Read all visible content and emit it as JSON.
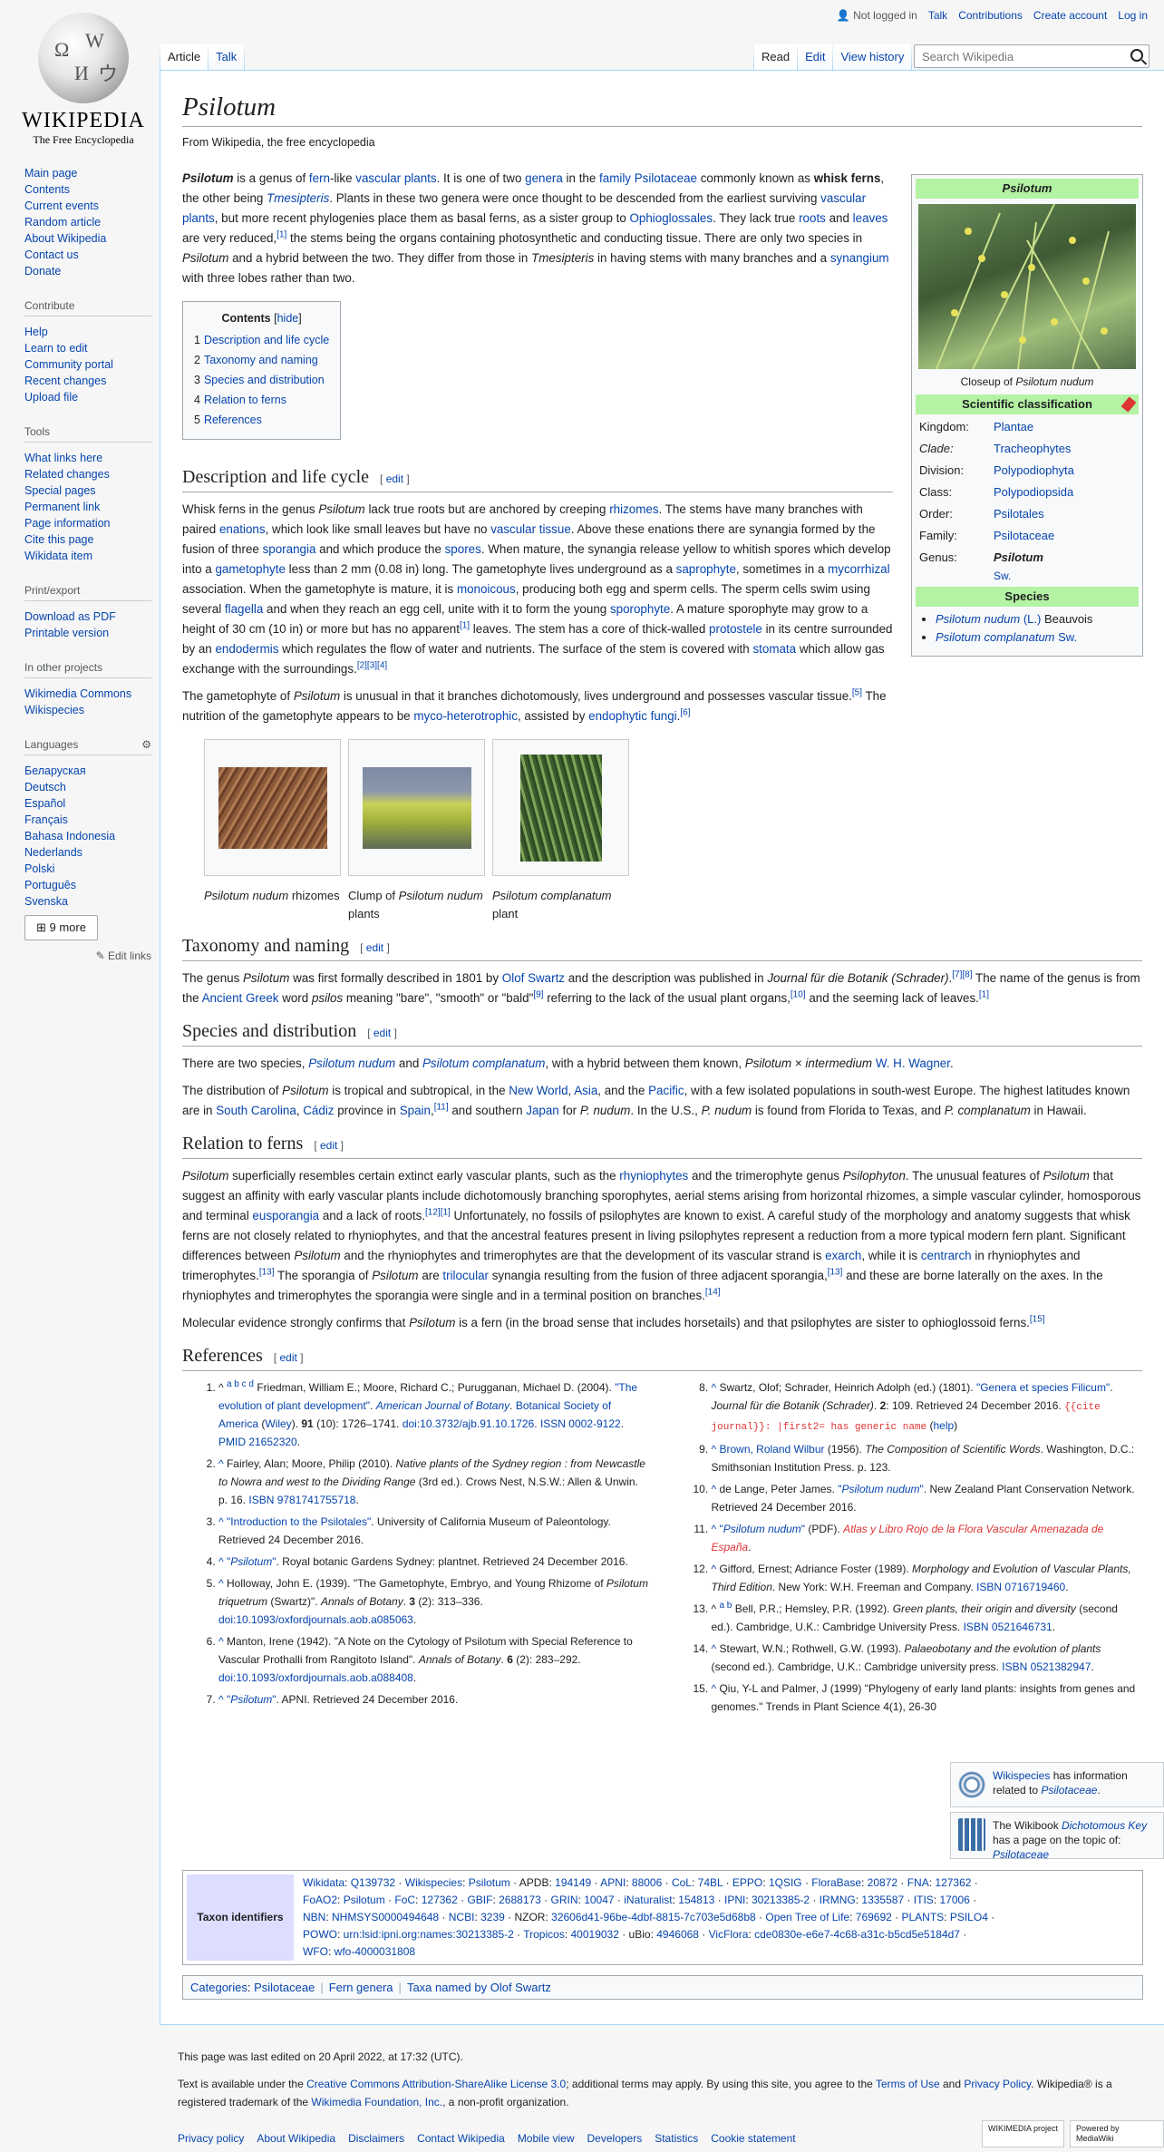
{
  "personal": {
    "not_logged": "Not logged in",
    "talk": "Talk",
    "contributions": "Contributions",
    "create": "Create account",
    "login": "Log in"
  },
  "logo": {
    "wordmark": "WIKIPEDIA",
    "tagline": "The Free Encyclopedia"
  },
  "tabs": {
    "article": "Article",
    "talk": "Talk",
    "read": "Read",
    "edit": "Edit",
    "history": "View history"
  },
  "search": {
    "placeholder": "Search Wikipedia"
  },
  "sidebar": {
    "nav": [
      "Main page",
      "Contents",
      "Current events",
      "Random article",
      "About Wikipedia",
      "Contact us",
      "Donate"
    ],
    "contribute_h": "Contribute",
    "contribute": [
      "Help",
      "Learn to edit",
      "Community portal",
      "Recent changes",
      "Upload file"
    ],
    "tools_h": "Tools",
    "tools": [
      "What links here",
      "Related changes",
      "Special pages",
      "Permanent link",
      "Page information",
      "Cite this page",
      "Wikidata item"
    ],
    "print_h": "Print/export",
    "print": [
      "Download as PDF",
      "Printable version"
    ],
    "projects_h": "In other projects",
    "projects": [
      "Wikimedia Commons",
      "Wikispecies"
    ],
    "lang_h": "Languages",
    "langs": [
      "Беларуская",
      "Deutsch",
      "Español",
      "Français",
      "Bahasa Indonesia",
      "Nederlands",
      "Polski",
      "Português",
      "Svenska"
    ],
    "more": "9 more",
    "edit_links": "Edit links"
  },
  "article": {
    "title": "Psilotum",
    "from": "From Wikipedia, the free encyclopedia"
  },
  "infobox": {
    "title": "Psilotum",
    "caption_pre": "Closeup of ",
    "caption_it": "Psilotum nudum",
    "sci": "Scientific classification",
    "rows": [
      [
        "Kingdom:",
        "Plantae"
      ],
      [
        "Clade:",
        "Tracheophytes"
      ],
      [
        "Division:",
        "Polypodiophyta"
      ],
      [
        "Class:",
        "Polypodiopsida"
      ],
      [
        "Order:",
        "Psilotales"
      ],
      [
        "Family:",
        "Psilotaceae"
      ],
      [
        "Genus:",
        "Psilotum"
      ]
    ],
    "genus_auth": "Sw.",
    "species_h": "Species",
    "sp1": "Psilotum nudum",
    "sp1a": "(L.)",
    "sp1b": " Beauvois",
    "sp2": "Psilotum complanatum",
    "sp2a": "Sw."
  },
  "toc": {
    "title": "Contents",
    "hide": "hide",
    "items": [
      "Description and life cycle",
      "Taxonomy and naming",
      "Species and distribution",
      "Relation to ferns",
      "References"
    ]
  },
  "sections": {
    "desc": "Description and life cycle",
    "tax": "Taxonomy and naming",
    "spec": "Species and distribution",
    "rel": "Relation to ferns",
    "refs": "References",
    "edit": "edit"
  },
  "gallery": [
    {
      "it": "Psilotum nudum",
      "rest": " rhizomes",
      "pre": ""
    },
    {
      "pre": "Clump of ",
      "it": "Psilotum nudum",
      "rest": " plants"
    },
    {
      "pre": "",
      "it": "Psilotum complanatum",
      "rest": " plant"
    }
  ],
  "sister": {
    "ws_a": "Wikispecies",
    "ws_b": " has information related to ",
    "ws_c": "Psilotaceae",
    "wb_a": "The Wikibook ",
    "wb_b": "Dichotomous Key",
    "wb_c": " has a page on the topic of: ",
    "wb_d": "Psilotaceae"
  },
  "taxon": {
    "label": "Taxon identifiers"
  },
  "cats": {
    "label": "Categories",
    "items": [
      "Psilotaceae",
      "Fern genera",
      "Taxa named by Olof Swartz"
    ]
  },
  "footer": {
    "edited": "This page was last edited on 20 April 2022, at 17:32 (UTC).",
    "links": [
      "Privacy policy",
      "About Wikipedia",
      "Disclaimers",
      "Contact Wikipedia",
      "Mobile view",
      "Developers",
      "Statistics",
      "Cookie statement"
    ],
    "wmf": "WIKIMEDIA project",
    "mw": "Powered by MediaWiki"
  }
}
